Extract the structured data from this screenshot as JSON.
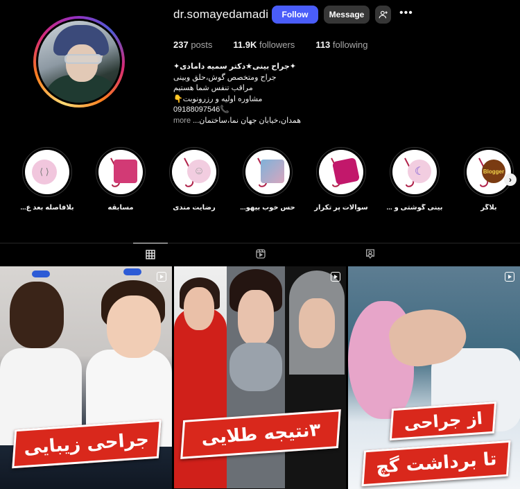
{
  "profile": {
    "username": "dr.somayedamadi",
    "follow_label": "Follow",
    "message_label": "Message",
    "more_label": "•••",
    "stats": {
      "posts_count": "237",
      "posts_label": "posts",
      "followers_count": "11.9K",
      "followers_label": "followers",
      "following_count": "113",
      "following_label": "following"
    },
    "bio": {
      "line1": "✦جراح بینی★دکتر سمیه دامادی✦",
      "line2": "جراح ومتخصص گوش،حلق وبینی",
      "line3": "مراقب تنفس شما هستیم",
      "line4": "مشاوره اولیه و رزرونوبت👇",
      "line5": "09188097546📞",
      "line6": "همدان،خیابان جهان نما،ساختمان...",
      "more_label": "more"
    }
  },
  "highlights": [
    {
      "label": "بلاگر",
      "badge": "Blogger"
    },
    {
      "label": "بینی گوشتی و ...",
      "badge": "moon"
    },
    {
      "label": "سوالات پر تکرار",
      "badge": "faq"
    },
    {
      "label": "حس خوب بیهو...",
      "badge": "photo"
    },
    {
      "label": "رضایت مندی",
      "badge": "smile"
    },
    {
      "label": "مسابقه",
      "badge": "gift"
    },
    {
      "label": "بلافاصله بعد ع...",
      "badge": "lungs"
    }
  ],
  "tabs": [
    {
      "name": "posts-grid",
      "active": true
    },
    {
      "name": "reels",
      "active": false
    },
    {
      "name": "tagged",
      "active": false
    }
  ],
  "posts": [
    {
      "caption": "جراحی زیبایی"
    },
    {
      "caption": "۳نتیجه طلایی"
    },
    {
      "caption_line1": "از جراحی",
      "caption_line2": "تا برداشت گچ"
    }
  ],
  "colors": {
    "follow_button": "#4a5df9",
    "secondary_button": "#363636",
    "banner_red": "#d9281c",
    "background": "#000000"
  }
}
